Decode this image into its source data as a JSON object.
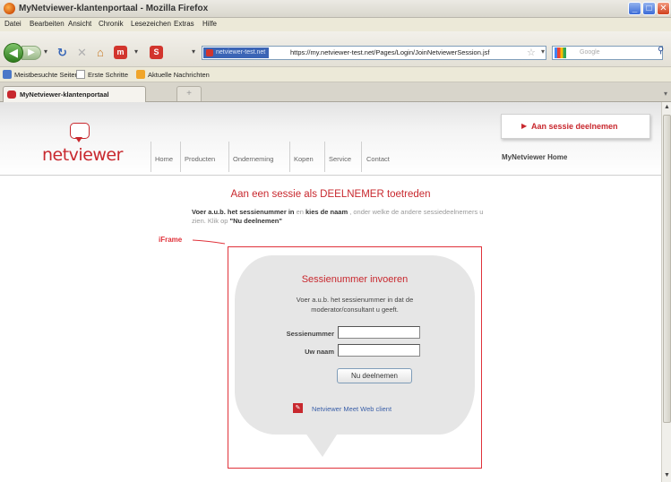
{
  "window": {
    "title": "MyNetviewer-klantenportaal - Mozilla Firefox"
  },
  "menubar": [
    "Datei",
    "Bearbeiten",
    "Ansicht",
    "Chronik",
    "Lesezeichen",
    "Extras",
    "Hilfe"
  ],
  "toolbar": {
    "site_identity": "netviewer-test.net",
    "url": "https://my.netviewer-test.net/Pages/Login/JoinNetviewerSession.jsf",
    "search_placeholder": "Google"
  },
  "bookmarks": [
    "Meistbesuchte Seiten",
    "Erste Schritte",
    "Aktuelle Nachrichten"
  ],
  "tabs": [
    {
      "label": "MyNetviewer-klantenportaal"
    }
  ],
  "site": {
    "logo": "netviewer",
    "nav": [
      "Home",
      "Producten",
      "Onderneming",
      "Kopen",
      "Service",
      "Contact"
    ],
    "cta": "Aan sessie deelnemen",
    "my_home": "MyNetviewer Home"
  },
  "page": {
    "title": "Aan een sessie als DEELNEMER toetreden",
    "intro": {
      "b1": "Voer a.u.b. het sessienummer in",
      "t1": " en ",
      "b2": "kies de naam",
      "t2": " , onder welke de andere sessiedeelnemers u zien. Klik op ",
      "b3": "\"Nu deelnemen\""
    },
    "iframe_label": "iFrame"
  },
  "form": {
    "title": "Sessienummer invoeren",
    "description": "Voer a.u.b. het sessienummer in dat de moderator/consultant u geeft.",
    "session_label": "Sessienummer",
    "name_label": "Uw naam",
    "session_value": "",
    "name_value": "",
    "submit": "Nu deelnemen",
    "webclient": "Netviewer Meet Web client"
  },
  "colors": {
    "brand_red": "#c8282e",
    "link_blue": "#3a5fa8"
  }
}
